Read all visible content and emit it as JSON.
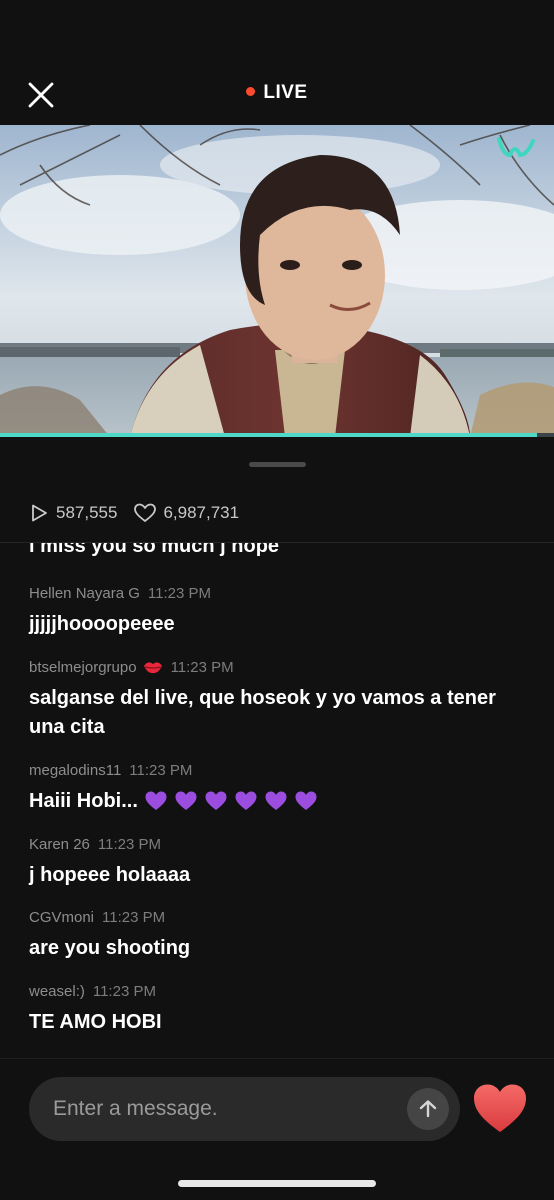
{
  "header": {
    "live_label": "LIVE",
    "live_color": "#ff4a2e"
  },
  "video": {
    "logo": "weverse-logo",
    "progress_fraction": 0.97,
    "accent": "#4fd8c8"
  },
  "stats": {
    "plays": "587,555",
    "likes": "6,987,731"
  },
  "chat": {
    "partial_message": "i miss you so much j hope",
    "messages": [
      {
        "user": "Hellen Nayara G",
        "time": "11:23 PM",
        "text": "jjjjjhoooopeeee"
      },
      {
        "user": "btselmejorgrupo",
        "time": "11:23 PM",
        "text": "salganse del live, que hoseok y yo vamos a tener una cita",
        "user_emoji": "lips-emoji"
      },
      {
        "user": "megalodins11",
        "time": "11:23 PM",
        "text": "Haiii Hobi...",
        "trailing_emoji": "purple-heart-emoji",
        "emoji_count": 6
      },
      {
        "user": "Karen 26",
        "time": "11:23 PM",
        "text": "j hopeee holaaaa"
      },
      {
        "user": "CGVmoni",
        "time": "11:23 PM",
        "text": "are you shooting"
      },
      {
        "user": "weasel:)",
        "time": "11:23 PM",
        "text": "TE AMO HOBI"
      }
    ]
  },
  "composer": {
    "placeholder": "Enter a message.",
    "send_icon": "arrow-up-icon",
    "like_icon": "heart-icon",
    "like_color": "#e8494b"
  }
}
